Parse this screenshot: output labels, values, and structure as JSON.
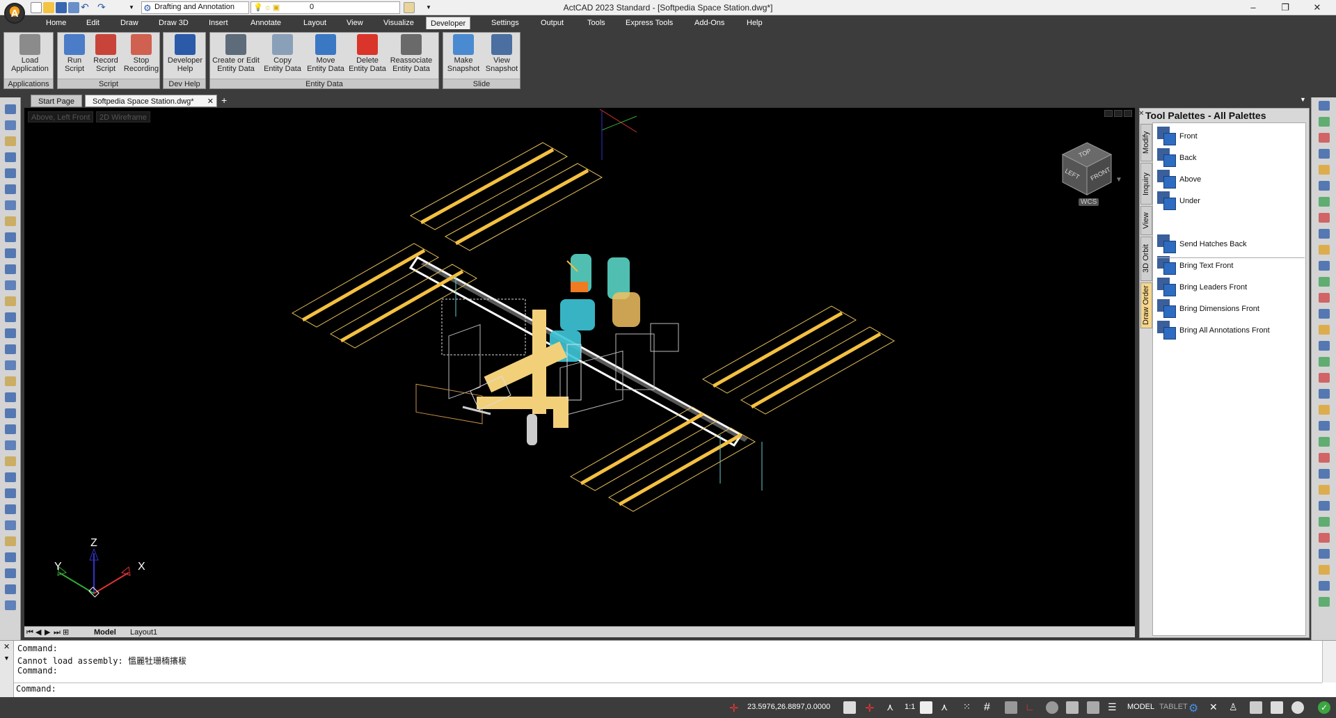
{
  "window": {
    "title": "ActCAD 2023 Standard - [Softpedia Space Station.dwg*]",
    "logo_letter": "A",
    "workspace": "Drafting and Annotation",
    "layer": "0",
    "buttons": {
      "minimize": "–",
      "restore": "❐",
      "close": "✕"
    }
  },
  "menu": {
    "tabs": [
      "Home",
      "Edit",
      "Draw",
      "Draw 3D",
      "Insert",
      "Annotate",
      "Layout",
      "View",
      "Visualize",
      "Developer",
      "Settings",
      "Output",
      "Tools",
      "Express Tools",
      "Add-Ons",
      "Help"
    ],
    "active": "Developer"
  },
  "ribbon": {
    "panels": [
      {
        "title": "Applications",
        "buttons": [
          "Load\nApplication"
        ]
      },
      {
        "title": "Script",
        "buttons": [
          "Run\nScript",
          "Record\nScript",
          "Stop\nRecording"
        ]
      },
      {
        "title": "Dev Help",
        "buttons": [
          "Developer\nHelp"
        ]
      },
      {
        "title": "Entity Data",
        "buttons": [
          "Create or Edit\nEntity Data",
          "Copy\nEntity Data",
          "Move\nEntity Data",
          "Delete\nEntity Data",
          "Reassociate\nEntity Data"
        ]
      },
      {
        "title": "Slide",
        "buttons": [
          "Make\nSnapshot",
          "View\nSnapshot"
        ]
      }
    ]
  },
  "doc_tabs": {
    "start": "Start Page",
    "active": "Softpedia Space Station.dwg*",
    "close": "✕",
    "add": "+"
  },
  "viewport": {
    "view_label": "Above, Left Front",
    "style_label": "2D Wireframe",
    "viewcube": {
      "top": "TOP",
      "left": "LEFT",
      "front": "FRONT",
      "wcs": "WCS"
    },
    "ucs": {
      "x": "X",
      "y": "Y",
      "z": "Z"
    }
  },
  "layout_tabs": {
    "model": "Model",
    "layout1": "Layout1"
  },
  "palette": {
    "title": "Tool Palettes - All Palettes",
    "close": "✕",
    "tabs": [
      "Modify",
      "Inquiry",
      "View",
      "3D Orbit",
      "Draw Order"
    ],
    "active_tab": "Draw Order",
    "items_top": [
      "Front",
      "Back",
      "Above",
      "Under"
    ],
    "items_bottom": [
      "Send Hatches Back",
      "Bring Text Front",
      "Bring Leaders Front",
      "Bring Dimensions Front",
      "Bring All Annotations Front"
    ]
  },
  "command": {
    "lines": [
      "Command:",
      "Cannot load assembly: 慍麗牡珊楠攐秡",
      "Command:"
    ],
    "prompt": "Command:"
  },
  "status": {
    "coords": "23.5976,26.8897,0.0000",
    "scale": "1:1",
    "model": "MODEL",
    "tablet": "TABLET"
  },
  "colors": {
    "accent_orange": "#f7a21b",
    "background_dark": "#3c3c3c",
    "panel_blue": "#2b5aa8",
    "draw_order_tab": "#f7d68a"
  }
}
